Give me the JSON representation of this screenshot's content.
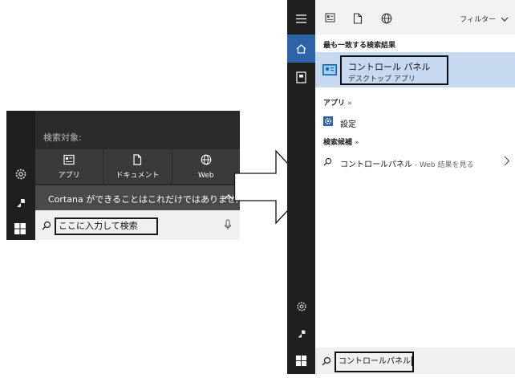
{
  "left_panel": {
    "search_in_label": "検索対象:",
    "tabs": [
      {
        "label": "アプリ",
        "icon": "apps-icon"
      },
      {
        "label": "ドキュメント",
        "icon": "document-icon"
      },
      {
        "label": "Web",
        "icon": "globe-icon"
      }
    ],
    "cortana_text": "Cortana ができることはこれだけではありません...",
    "search_placeholder": "ここに入力して検索",
    "rail_icons": [
      "gear-icon",
      "cortana-icon",
      "windows-icon"
    ]
  },
  "right_panel": {
    "filter_label": "フィルター",
    "best_match_heading": "最も一致する検索結果",
    "best_match": {
      "title": "コントロール パネル",
      "subtitle": "デスクトップ アプリ"
    },
    "apps_heading": "アプリ",
    "apps": [
      {
        "label": "設定"
      }
    ],
    "suggestions_heading": "検索候補",
    "suggestions": [
      {
        "label": "コントロールパネル",
        "suffix": " - Web 結果を見る"
      }
    ],
    "search_value": "コントロールパネル",
    "heading_chevron": "»"
  },
  "colors": {
    "accent": "#2e63a8",
    "highlight": "#c6d9f1",
    "taskbar_dark": "#1f1f1f",
    "menu_dark": "#2b2b2b"
  }
}
